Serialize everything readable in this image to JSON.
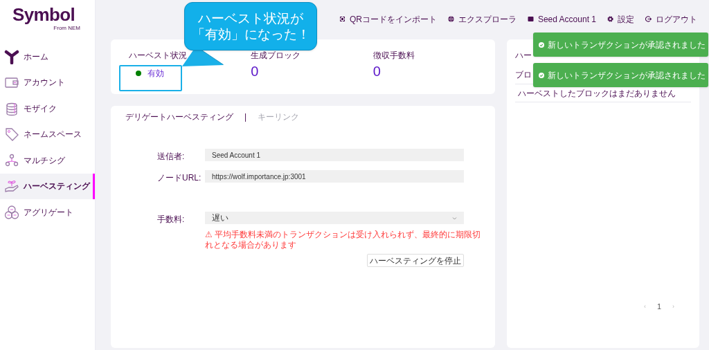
{
  "logo": {
    "name": "Symbol",
    "tagline": "From NEM"
  },
  "sidebar": {
    "items": [
      {
        "label": "ホーム",
        "selected": false
      },
      {
        "label": "アカウント",
        "selected": false
      },
      {
        "label": "モザイク",
        "selected": false
      },
      {
        "label": "ネームスペース",
        "selected": false
      },
      {
        "label": "マルチシグ",
        "selected": false
      },
      {
        "label": "ハーベスティング",
        "selected": true
      },
      {
        "label": "アグリゲート",
        "selected": false
      }
    ]
  },
  "header": {
    "links": [
      {
        "label": "QRコードをインポート"
      },
      {
        "label": "エクスプローラ"
      },
      {
        "label": "Seed Account 1"
      },
      {
        "label": "設定"
      },
      {
        "label": "ログアウト"
      }
    ]
  },
  "stats": [
    {
      "label": "ハーベスト状況",
      "kind": "status",
      "value": "有効"
    },
    {
      "label": "生成ブロック",
      "kind": "number",
      "value": "0"
    },
    {
      "label": "徴収手数料",
      "kind": "number",
      "value": "0"
    }
  ],
  "tabs": [
    {
      "label": "デリゲートハーベスティング",
      "selected": true
    },
    {
      "label": "キーリンク",
      "selected": false
    }
  ],
  "tab_separator": "|",
  "form": {
    "fields": [
      {
        "label": "送信者:",
        "kind": "text",
        "value": "Seed Account 1"
      },
      {
        "label": "ノードURL:",
        "kind": "text",
        "value": "https://wolf.importance.jp:3001"
      },
      {
        "label": "手数料:",
        "kind": "select",
        "value": "遅い"
      }
    ],
    "warning": "⚠ 平均手数料未満のトランザクションは受け入れられず、最終的に期限切れとなる場合があります",
    "button": "ハーベスティングを停止"
  },
  "harvested_panel": {
    "title": "ハー",
    "column_1": "ブロ",
    "empty_message": "ハーベストしたブロックはまだありません",
    "pagination": {
      "prev": "‹",
      "page": "1",
      "next": "›"
    }
  },
  "toasts": [
    {
      "message": "新しいトランザクションが承認されました"
    },
    {
      "message": "新しいトランザクションが承認されました"
    }
  ],
  "annotation": {
    "lines": [
      "ハーベスト状況が",
      "「有効」になった！"
    ]
  }
}
